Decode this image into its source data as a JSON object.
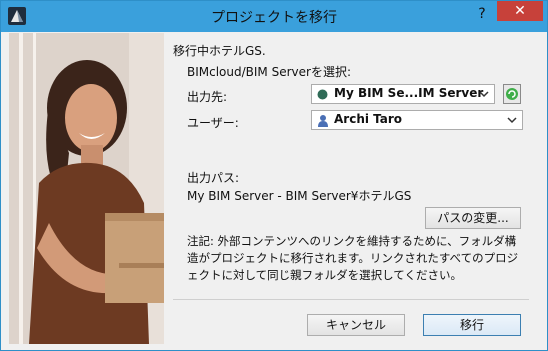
{
  "window": {
    "title": "プロジェクトを移行",
    "help_label": "?",
    "close_label": "✕"
  },
  "dialog": {
    "heading": "移行中ホテルGS.",
    "select_label": "BIMcloud/BIM Serverを選択:",
    "destination_label": "出力先:",
    "destination_value": "My BIM Se...IM Server",
    "user_label": "ユーザー:",
    "user_value": "Archi Taro",
    "output_path_label": "出力パス:",
    "output_path_value": "My BIM Server - BIM Server¥ホテルGS",
    "change_path_button": "パスの変更...",
    "note": "注記: 外部コンテンツへのリンクを維持するために、フォルダ構造がプロジェクトに移行されます。リンクされたすべてのプロジェクトに対して同じ親フォルダを選択してください。",
    "cancel_button": "キャンセル",
    "migrate_button": "移行"
  },
  "colors": {
    "titlebar": "#3aa0dc",
    "close_button": "#c7413a",
    "refresh_button": "#3fae49"
  }
}
